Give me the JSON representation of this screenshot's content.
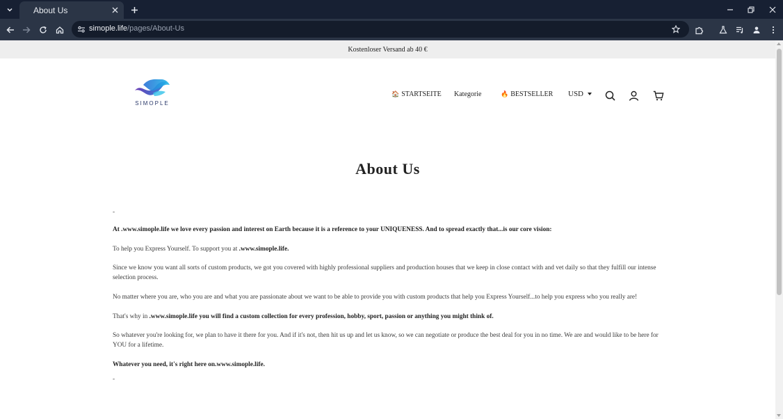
{
  "browser": {
    "tab_title": "About Us",
    "url_host": "simople.life",
    "url_path": "/pages/About-Us"
  },
  "store": {
    "announcement": "Kostenloser Versand ab 40 €",
    "logo_text": "SIMOPLE",
    "nav": [
      {
        "emoji": "🏠",
        "label": "STARTSEITE"
      },
      {
        "emoji": "",
        "label": "Kategorie"
      },
      {
        "emoji": "🔥",
        "label": "BESTSELLER"
      }
    ],
    "currency": "USD",
    "icons": [
      "search-icon",
      "account-icon",
      "cart-icon"
    ]
  },
  "page": {
    "title": "About Us",
    "dash_top": "-",
    "p1": "At .www.simople.life we love every passion and interest on Earth because it is a reference to your UNIQUENESS. And to spread exactly that...is our core vision:",
    "p2_a": "To help you Express Yourself. To support you at ",
    "p2_b": ".www.simople.life.",
    "p3": "Since we know you want all sorts of custom products, we got you covered with highly professional suppliers and production houses that we keep in close contact with and vet daily so that they fulfill our intense selection process.",
    "p4": "No matter where you are, who you are and what you are passionate about we want to be able to provide you with custom products that help you Express Yourself...to help you express who you really are!",
    "p5_a": "That's why in ",
    "p5_b": ".www.simople.life you will find a custom collection for every profession, hobby, sport, passion or anything you might think of.",
    "p6": "So whatever you're looking for, we plan to have it there for you. And if it's not, then hit us up and let us know, so we can negotiate or produce the best deal for you in no time. We are and would like to be here for YOU for a lifetime.",
    "p7": "Whatever you need, it's right here on.www.simople.life.",
    "dash_bottom": "-"
  }
}
